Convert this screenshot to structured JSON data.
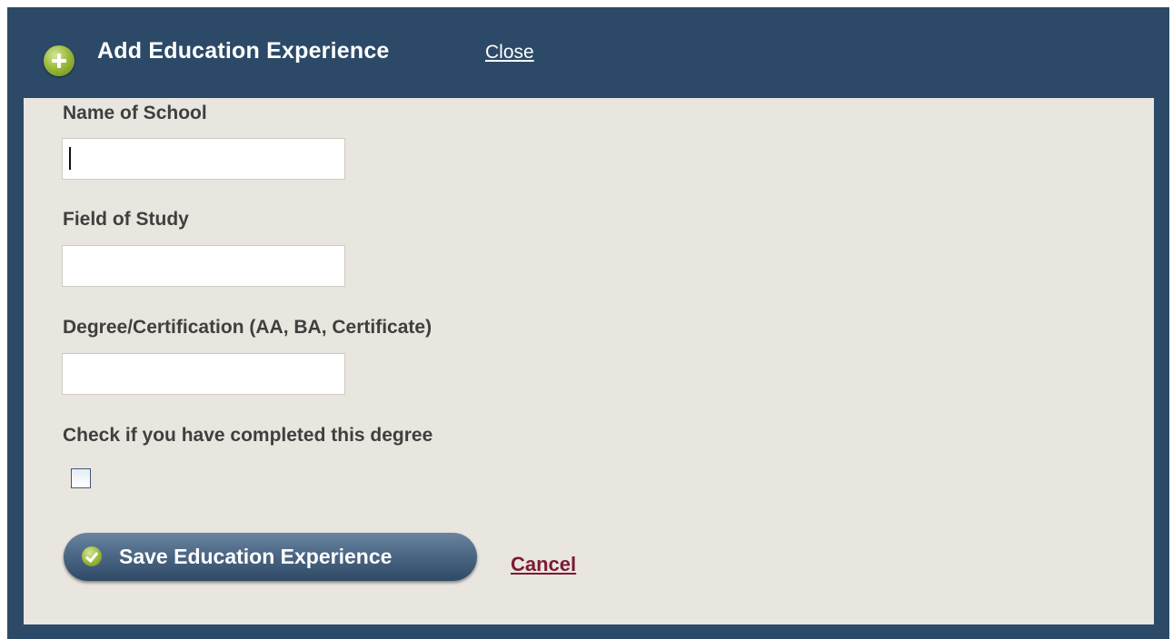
{
  "header": {
    "title": "Add Education Experience",
    "close_label": "Close",
    "icon": "plus-circle-icon"
  },
  "form": {
    "school": {
      "label": "Name of School",
      "value": "",
      "placeholder": ""
    },
    "field_of_study": {
      "label": "Field of Study",
      "value": "",
      "placeholder": ""
    },
    "degree": {
      "label": "Degree/Certification (AA, BA, Certificate)",
      "value": "",
      "placeholder": ""
    },
    "completed": {
      "label": "Check if you have completed this degree",
      "checked": false
    }
  },
  "actions": {
    "save_label": "Save Education Experience",
    "save_icon": "check-circle-icon",
    "cancel_label": "Cancel"
  },
  "colors": {
    "frame": "#2c4a68",
    "panel": "#e9e6df",
    "accent_green": "#9dbb3d",
    "cancel_link": "#7a1a35"
  }
}
